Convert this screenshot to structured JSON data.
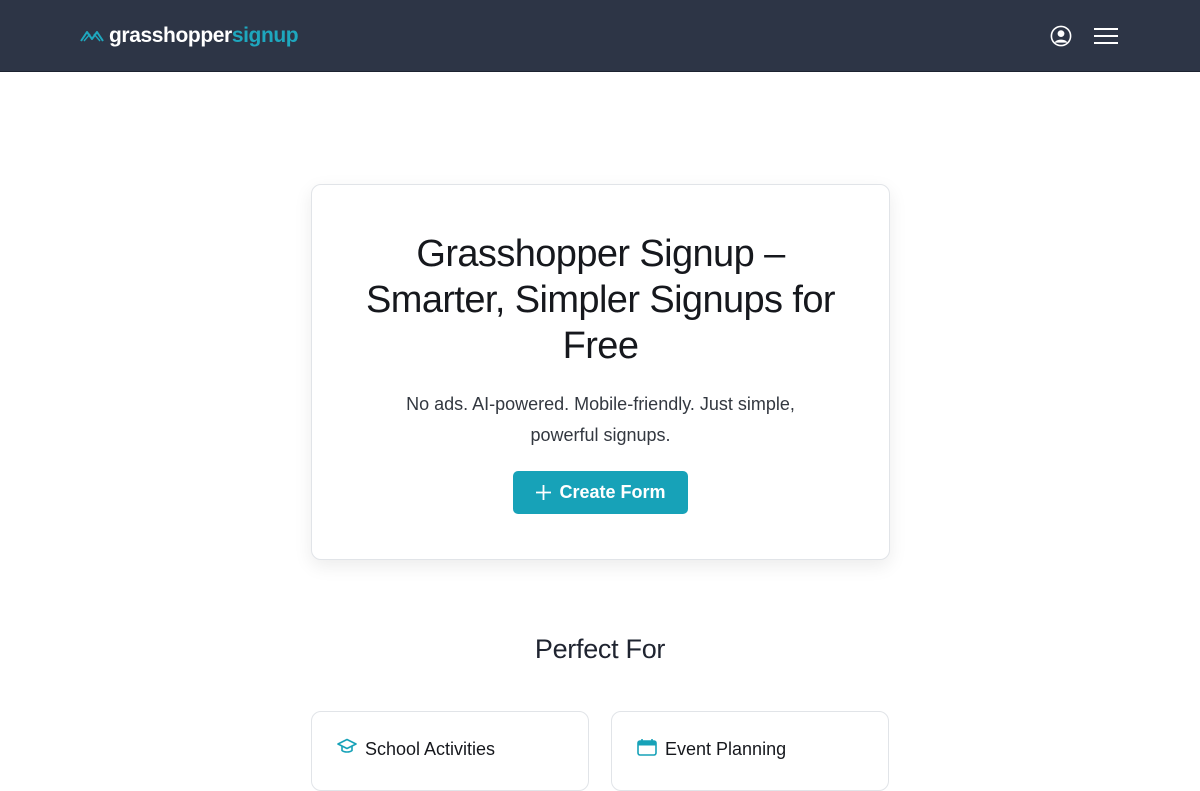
{
  "header": {
    "brand_part1": "grasshopper",
    "brand_part2": "signup",
    "brand_icon": "grasshopper-logo-icon",
    "account_icon": "user-circle-icon",
    "menu_icon": "hamburger-menu-icon"
  },
  "hero": {
    "title": "Grasshopper Signup – Smarter, Simpler Signups for Free",
    "subtitle": "No ads. AI-powered. Mobile-friendly. Just simple, powerful signups.",
    "cta_label": "Create Form",
    "cta_icon": "plus-icon"
  },
  "section": {
    "title": "Perfect For",
    "cards": [
      {
        "label": "School Activities",
        "icon": "graduation-cap-icon"
      },
      {
        "label": "Event Planning",
        "icon": "calendar-icon"
      }
    ]
  },
  "colors": {
    "navbar_bg": "#2d3546",
    "accent": "#17a2b8",
    "brand_accent": "#1ea7be"
  }
}
